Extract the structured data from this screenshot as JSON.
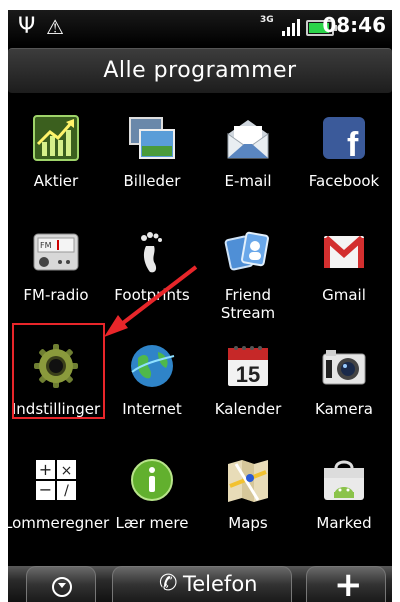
{
  "status_bar": {
    "time": "08:46",
    "network": "3G",
    "usb_icon": "usb-icon",
    "warning_icon": "warning-icon",
    "signal_level": 4,
    "battery_percent": 85,
    "battery_color": "#2bd34a"
  },
  "title": "Alle programmer",
  "apps": [
    {
      "label": "Aktier",
      "icon": "stocks-icon"
    },
    {
      "label": "Billeder",
      "icon": "gallery-icon"
    },
    {
      "label": "E-mail",
      "icon": "email-icon"
    },
    {
      "label": "Facebook",
      "icon": "facebook-icon"
    },
    {
      "label": "FM-radio",
      "icon": "fm-radio-icon"
    },
    {
      "label": "Footprints",
      "icon": "footprints-icon"
    },
    {
      "label": "Friend\nStream",
      "icon": "friend-stream-icon"
    },
    {
      "label": "Gmail",
      "icon": "gmail-icon"
    },
    {
      "label": "Indstillinger",
      "icon": "settings-gear-icon"
    },
    {
      "label": "Internet",
      "icon": "globe-icon"
    },
    {
      "label": "Kalender",
      "icon": "calendar-icon"
    },
    {
      "label": "Kamera",
      "icon": "camera-icon"
    },
    {
      "label": "Lommeregner",
      "icon": "calculator-icon"
    },
    {
      "label": "Lær mere",
      "icon": "info-icon"
    },
    {
      "label": "Maps",
      "icon": "maps-icon"
    },
    {
      "label": "Marked",
      "icon": "market-icon"
    }
  ],
  "calendar_day": "15",
  "dock": {
    "call_label": "Telefon",
    "add_label": "+"
  },
  "annotation": {
    "highlight_color": "#e8262a",
    "arrow_color": "#e8262a"
  }
}
